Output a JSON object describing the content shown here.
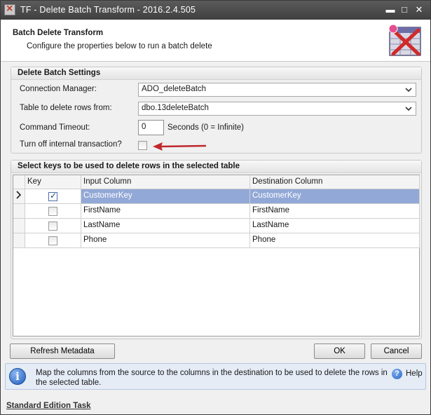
{
  "window": {
    "title": "TF - Delete Batch Transform - 2016.2.4.505",
    "controls": {
      "close": "✕",
      "maximize": "□",
      "minimize": "▬"
    }
  },
  "header": {
    "title": "Batch Delete Transform",
    "subtitle": "Configure the properties below to run a batch delete"
  },
  "settings": {
    "group_title": "Delete Batch Settings",
    "connection_manager_label": "Connection Manager:",
    "connection_manager_value": "ADO_deleteBatch",
    "table_label": "Table to delete rows from:",
    "table_value": "dbo.13deleteBatch",
    "timeout_label": "Command Timeout:",
    "timeout_value": "0",
    "timeout_hint": "Seconds (0 = Infinite)",
    "transaction_label": "Turn off internal transaction?",
    "transaction_checked": false
  },
  "keys": {
    "group_title": "Select keys to be used to delete rows in the selected table",
    "columns": [
      "Key",
      "Input Column",
      "Destination Column"
    ],
    "rows": [
      {
        "key": true,
        "input": "CustomerKey",
        "destination": "CustomerKey",
        "selected": true
      },
      {
        "key": false,
        "input": "FirstName",
        "destination": "FirstName",
        "selected": false
      },
      {
        "key": false,
        "input": "LastName",
        "destination": "LastName",
        "selected": false
      },
      {
        "key": false,
        "input": "Phone",
        "destination": "Phone",
        "selected": false
      }
    ]
  },
  "buttons": {
    "refresh": "Refresh Metadata",
    "ok": "OK",
    "cancel": "Cancel"
  },
  "info": {
    "icon": "info-icon",
    "text": "Map the columns from the source to the columns in the destination to be used to delete the rows in the selected table.",
    "help_label": "Help"
  },
  "footer": {
    "edition_link": "Standard Edition Task"
  },
  "colors": {
    "selection": "#92a8d6",
    "titlebar": "#4a4a4a",
    "arrow": "#c0282d"
  }
}
